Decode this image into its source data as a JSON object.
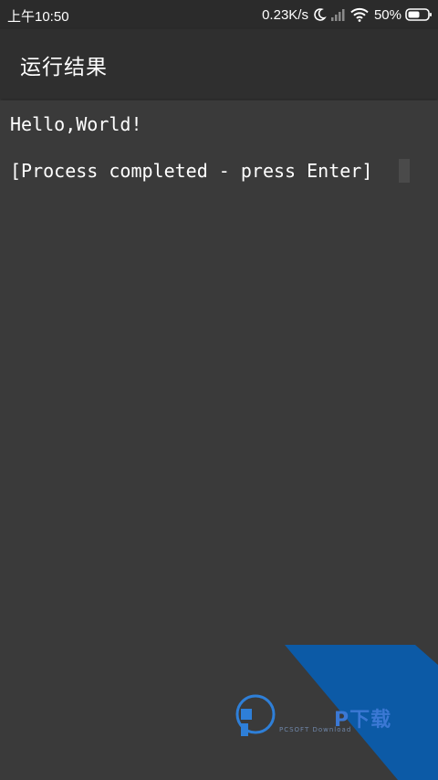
{
  "status_bar": {
    "time": "上午10:50",
    "network_speed": "0.23K/s",
    "battery": "50%",
    "icons": [
      "moon-icon",
      "signal-icon",
      "wifi-icon",
      "battery-icon"
    ]
  },
  "app_bar": {
    "title": "运行结果"
  },
  "terminal": {
    "lines": [
      "Hello,World!",
      "[Process completed - press Enter]"
    ]
  },
  "watermark": {
    "text_cn": "P下载",
    "text_en": "PCSOFT Download",
    "color": "#1a5fb4"
  },
  "colors": {
    "background": "#3a3a3a",
    "app_bar": "#2f2f2f",
    "status_bar": "#2b2b2b",
    "text": "#ffffff"
  }
}
